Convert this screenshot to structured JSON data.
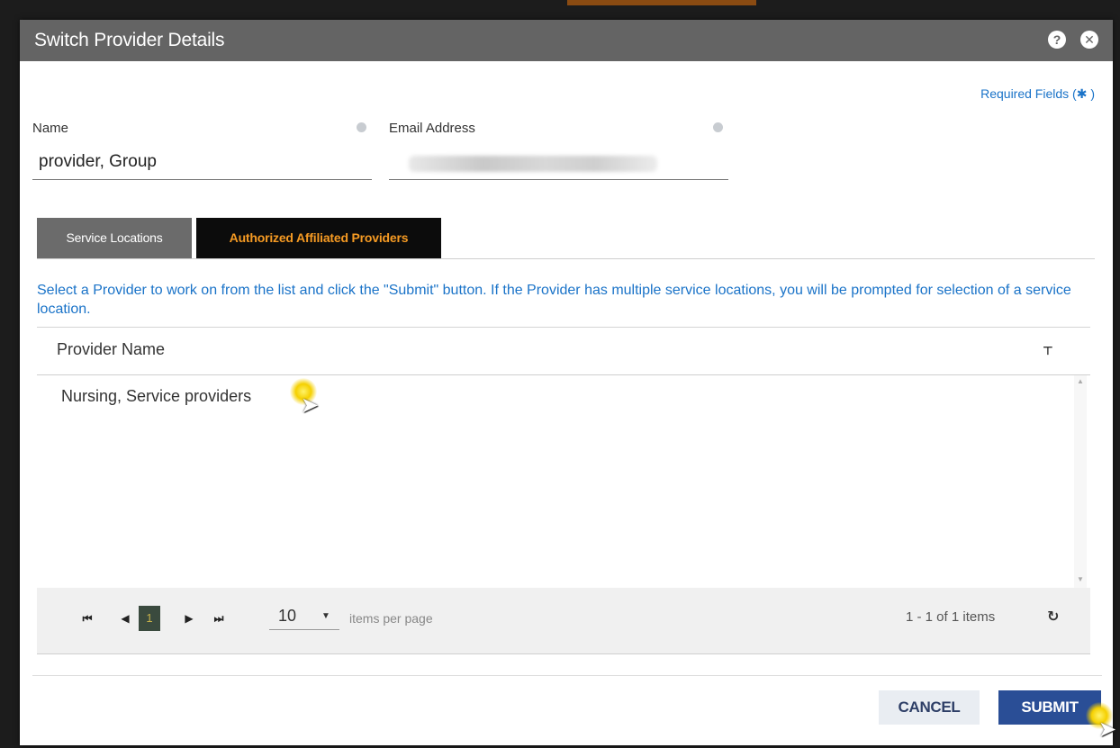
{
  "dialog": {
    "title": "Switch Provider Details",
    "help_icon": "?",
    "close_icon": "✕"
  },
  "form": {
    "required_label": "Required Fields (",
    "required_star": "✱",
    "required_close": " )",
    "name_label": "Name",
    "name_value": "provider, Group",
    "email_label": "Email Address"
  },
  "tabs": [
    {
      "label": "Service Locations",
      "active": false
    },
    {
      "label": "Authorized Affiliated Providers",
      "active": true
    }
  ],
  "instructions": "Select a Provider to work on from the list and click the \"Submit\" button. If the Provider has multiple service locations, you will be prompted for selection of a service location.",
  "grid": {
    "column_header": "Provider Name",
    "filter_icon": "⊤",
    "rows": [
      "Nursing, Service providers"
    ]
  },
  "pager": {
    "first_icon": "⏮",
    "prev_icon": "◀",
    "current_page": "1",
    "next_icon": "▶",
    "last_icon": "⏭",
    "page_size": "10",
    "page_size_caret": "▼",
    "items_per_page_label": "items per page",
    "info": "1 - 1 of 1 items",
    "refresh_icon": "↻"
  },
  "footer": {
    "cancel_label": "CANCEL",
    "submit_label": "SUBMIT"
  },
  "colors": {
    "titlebar": "#646464",
    "accent_tab_text": "#f59a23",
    "link_blue": "#1a73c8",
    "submit_bg": "#2a4e96"
  }
}
